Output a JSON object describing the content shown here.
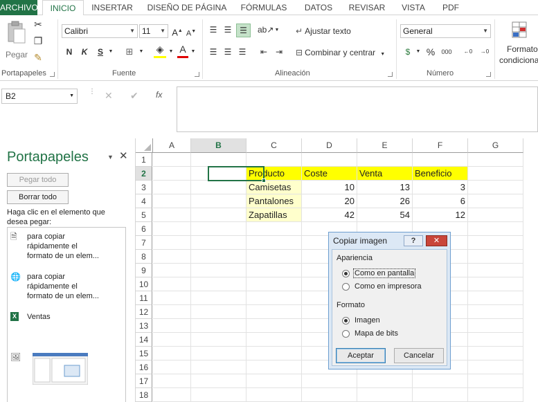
{
  "ribbon_tabs": [
    "ARCHIVO",
    "INICIO",
    "INSERTAR",
    "DISEÑO DE PÁGINA",
    "FÓRMULAS",
    "DATOS",
    "REVISAR",
    "VISTA",
    "PDF"
  ],
  "groups": {
    "clipboard": {
      "label": "Portapapeles",
      "paste_label": "Pegar"
    },
    "font": {
      "label": "Fuente",
      "font_name": "Calibri",
      "font_size": "11",
      "bold": "N",
      "italic": "K",
      "underline": "S"
    },
    "alignment": {
      "label": "Alineación",
      "wrap_text": "Ajustar texto",
      "merge_center": "Combinar y centrar"
    },
    "number": {
      "label": "Número",
      "format": "General"
    },
    "styles": {
      "cond_format_line1": "Formato",
      "cond_format_line2": "condiciona"
    }
  },
  "formula_bar": {
    "name_box": "B2",
    "fx": "fx"
  },
  "clipboard_pane": {
    "title": "Portapapeles",
    "paste_all": "Pegar todo",
    "clear_all": "Borrar todo",
    "instructions": "Haga clic en el elemento que desea pegar:",
    "items": [
      {
        "icon": "document-icon",
        "lines": [
          "para copiar",
          "rápidamente el",
          "formato de un elem..."
        ]
      },
      {
        "icon": "web-document-icon",
        "lines": [
          "para copiar",
          "rápidamente el",
          "formato de un elem..."
        ]
      },
      {
        "icon": "excel-icon",
        "lines": [
          "Ventas"
        ]
      },
      {
        "icon": "picture-icon",
        "lines": []
      }
    ]
  },
  "grid": {
    "columns": [
      "A",
      "B",
      "C",
      "D",
      "E",
      "F",
      "G"
    ],
    "rows": [
      "1",
      "2",
      "3",
      "4",
      "5",
      "6",
      "7",
      "8",
      "9",
      "10",
      "11",
      "12",
      "13",
      "14",
      "15",
      "16",
      "17",
      "18"
    ],
    "selected_cell": "B2",
    "table": {
      "headers": [
        "Producto",
        "Coste",
        "Venta",
        "Beneficio"
      ],
      "rows": [
        [
          "Camisetas",
          "10",
          "13",
          "3"
        ],
        [
          "Pantalones",
          "20",
          "26",
          "6"
        ],
        [
          "Zapatillas",
          "42",
          "54",
          "12"
        ]
      ]
    },
    "colors": {
      "header_fill": "#ffff00",
      "product_fill": "#ffffcc",
      "select_green": "#217346"
    }
  },
  "dialog": {
    "title": "Copiar imagen",
    "help": "?",
    "appearance_label": "Apariencia",
    "appearance_options": [
      "Como en pantalla",
      "Como en impresora"
    ],
    "appearance_selected": 0,
    "format_label": "Formato",
    "format_options": [
      "Imagen",
      "Mapa de bits"
    ],
    "format_selected": 0,
    "ok": "Aceptar",
    "cancel": "Cancelar"
  }
}
